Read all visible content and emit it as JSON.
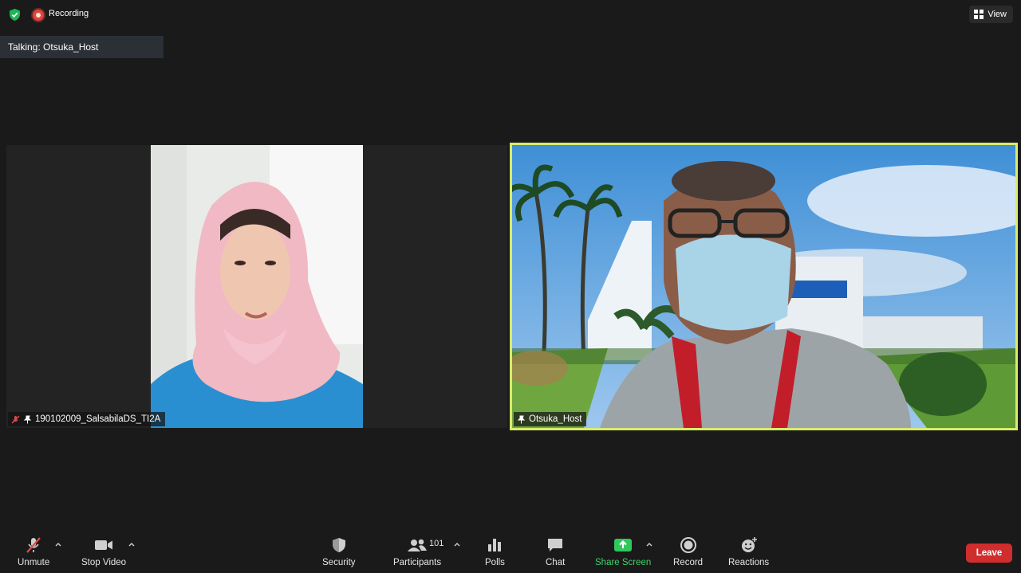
{
  "topbar": {
    "security_icon": "shield-check-icon",
    "recording_label": "Recording",
    "view_label": "View"
  },
  "talking": {
    "text": "Talking: Otsuka_Host"
  },
  "participants": [
    {
      "name": "190102009_SalsabilaDS_TI2A",
      "muted": true,
      "pinned": true
    },
    {
      "name": "Otsuka_Host",
      "muted": false,
      "pinned": true,
      "active_speaker": true
    }
  ],
  "toolbar": {
    "unmute_label": "Unmute",
    "stop_video_label": "Stop Video",
    "security_label": "Security",
    "participants_label": "Participants",
    "participants_count": "101",
    "polls_label": "Polls",
    "chat_label": "Chat",
    "share_screen_label": "Share Screen",
    "record_label": "Record",
    "reactions_label": "Reactions",
    "leave_label": "Leave"
  },
  "colors": {
    "background": "#1a1a1a",
    "active_speaker_border": "#d9ec6b",
    "share_green": "#3ed46b",
    "leave_red": "#d02d2d",
    "recording_red": "#e0453a"
  }
}
